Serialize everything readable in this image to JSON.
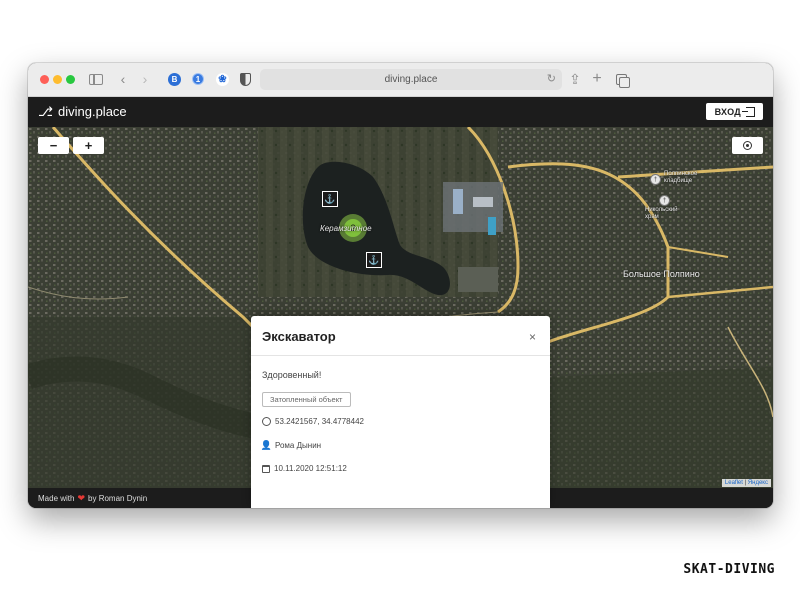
{
  "browser": {
    "address": "diving.place",
    "extensions": [
      "B",
      "1",
      "❀"
    ]
  },
  "app": {
    "logo_text": "diving.place",
    "login_label": "ВХОД"
  },
  "map": {
    "zoom_out": "−",
    "zoom_in": "+",
    "cluster_count": "2",
    "lake_label": "Керамзитное",
    "town_label": "Большое Полпино",
    "cemetery_label": "Полпинское кладбище",
    "church_label": "Никольский храм",
    "attribution_leaflet": "Leaflet",
    "attribution_sep": " | ",
    "attribution_yandex": "Яндекс"
  },
  "footer": {
    "made_with": "Made with",
    "by": "by Roman Dynin"
  },
  "modal": {
    "title": "Экскаватор",
    "close": "×",
    "description": "Здоровенный!",
    "tag": "Затопленный объект",
    "coordinates": "53.2421567, 34.4778442",
    "author": "Рома Дынин",
    "date": "10.11.2020 12:51:12"
  },
  "watermark": "SKAT-DIVING",
  "colors": {
    "header_bg": "#1c1c1c",
    "cluster": "#7fbf3b",
    "heart": "#e53935"
  }
}
